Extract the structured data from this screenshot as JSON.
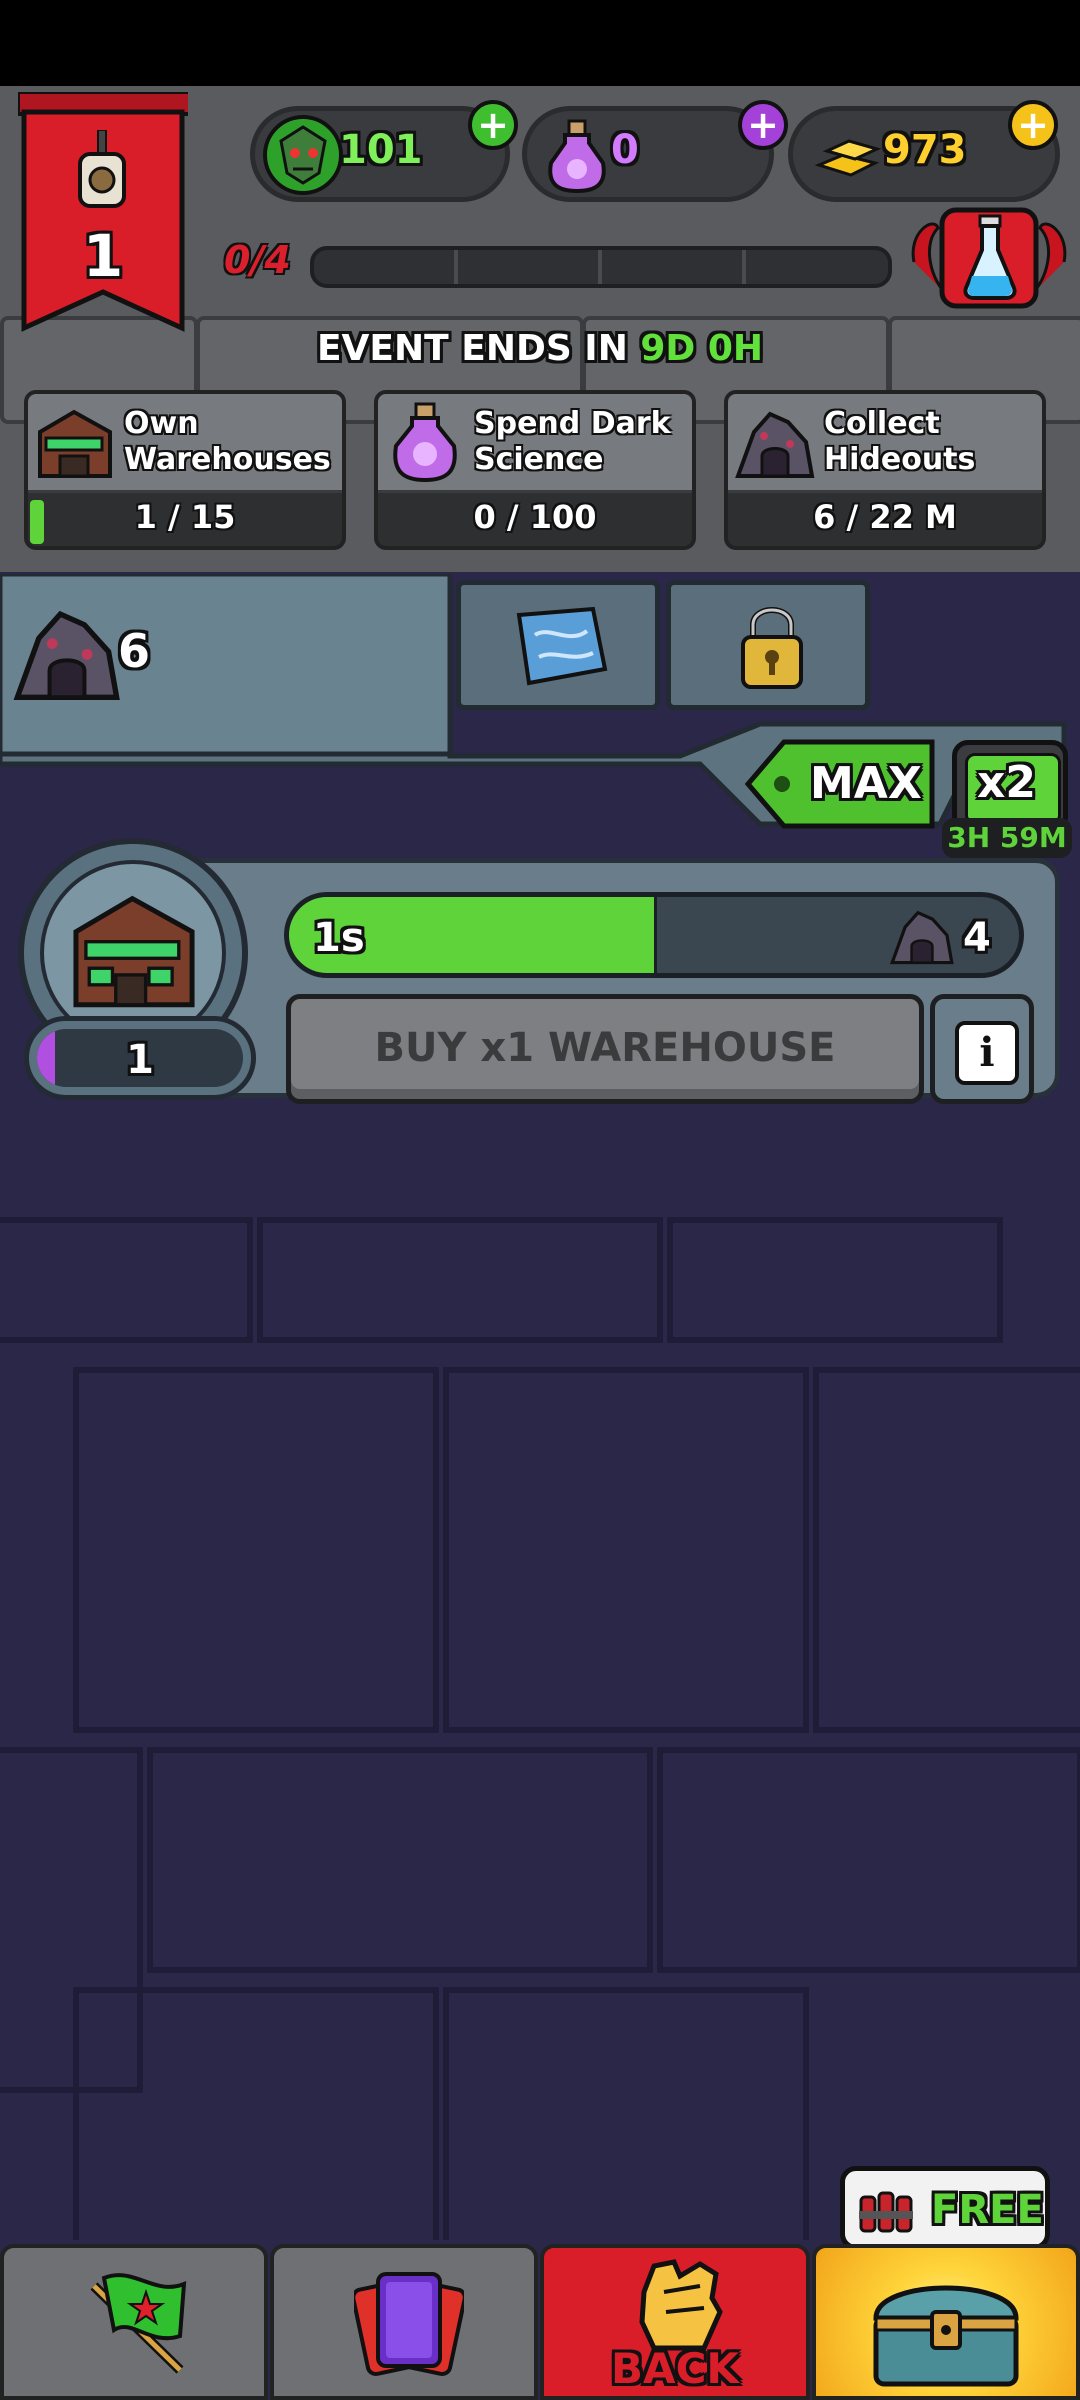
{
  "header": {
    "level": "1",
    "level_progress": "0/4",
    "level_progress_fraction": 0.0,
    "resources": [
      {
        "name": "zombie-heads",
        "value": "101",
        "icon": "zombie-head-icon",
        "color": "#3fbf2f"
      },
      {
        "name": "dark-science",
        "value": "0",
        "icon": "potion-bottle-icon",
        "color": "#b04fe0"
      },
      {
        "name": "gold",
        "value": "973",
        "icon": "gold-bars-icon",
        "color": "#f5c21a"
      }
    ]
  },
  "event": {
    "ends_label": "EVENT ENDS IN ",
    "ends_days": "9D",
    "ends_hours": "0H",
    "tasks": [
      {
        "label_line1": "Own",
        "label_line2": "Warehouses",
        "count": "1 / 15",
        "progress": 0.067,
        "icon": "warehouse-icon"
      },
      {
        "label_line1": "Spend Dark",
        "label_line2": "Science",
        "count": "0 / 100",
        "progress": 0.0,
        "icon": "potion-bottle-icon"
      },
      {
        "label_line1": "Collect",
        "label_line2": "Hideouts",
        "count": "6 / 22 M",
        "progress": 0.0,
        "icon": "hideout-icon"
      }
    ]
  },
  "tabs": {
    "hideouts_count": "6",
    "map_icon": "map-scroll-icon",
    "lock_icon": "padlock-icon"
  },
  "controls": {
    "max_label": "MAX",
    "boost_label": "x2",
    "boost_timer": "3H 59M"
  },
  "generator": {
    "owned": "1",
    "timer": "1s",
    "timer_progress": 0.5,
    "yield": "4",
    "buy_label": "BUY x1 WAREHOUSE",
    "info_label": "i"
  },
  "offer": {
    "free_label": "FREE"
  },
  "nav": {
    "back_label": "BACK",
    "items": [
      "flag-icon",
      "cards-icon",
      "fist-icon",
      "treasure-chest-icon"
    ]
  },
  "colors": {
    "banner_red": "#d91e2a",
    "green": "#5ed43a",
    "background": "#2a2748",
    "gold": "#f5c21a"
  }
}
